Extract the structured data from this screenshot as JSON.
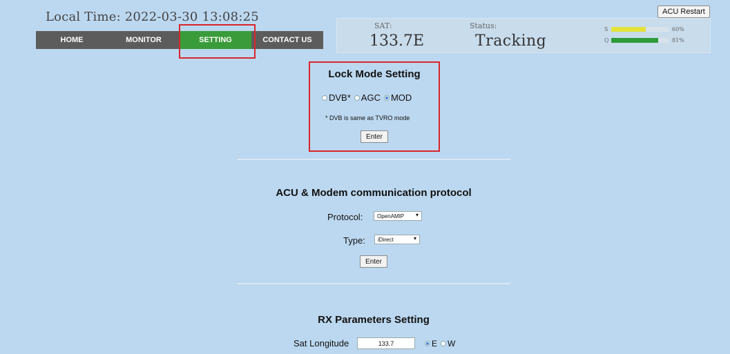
{
  "header": {
    "local_time": "Local Time: 2022-03-30 13:08:25",
    "acu_restart": "ACU Restart"
  },
  "nav": {
    "items": [
      {
        "label": "HOME"
      },
      {
        "label": "MONITOR"
      },
      {
        "label": "SETTING",
        "active": true
      },
      {
        "label": "CONTACT US"
      }
    ]
  },
  "status": {
    "sat_label": "SAT:",
    "sat_value": "133.7E",
    "status_label": "Status:",
    "status_value": "Tracking",
    "signal": {
      "label": "S",
      "percent_text": "60%",
      "value": 0.6,
      "color": "#e3e23a"
    },
    "quality": {
      "label": "Q",
      "percent_text": "81%",
      "value": 0.81,
      "color": "#2e9b3a"
    }
  },
  "lock_mode": {
    "title": "Lock Mode Setting",
    "options": [
      {
        "label": "DVB*",
        "checked": false
      },
      {
        "label": "AGC",
        "checked": false
      },
      {
        "label": "MOD",
        "checked": true
      }
    ],
    "note": "* DVB is same as TVRO mode",
    "enter": "Enter"
  },
  "acu_modem": {
    "title": "ACU & Modem communication protocol",
    "protocol_label": "Protocol:",
    "protocol_value": "OpenAMIP",
    "type_label": "Type:",
    "type_value": "iDirect",
    "enter": "Enter"
  },
  "rx_params": {
    "title": "RX Parameters Setting",
    "sat_longitude_label": "Sat Longitude",
    "sat_longitude_value": "133.7",
    "hemisphere": [
      {
        "label": "E",
        "checked": true
      },
      {
        "label": "W",
        "checked": false
      }
    ]
  },
  "colors": {
    "background": "#bcd8f0",
    "nav_bg": "#5c5c5c",
    "nav_active": "#3a9b3a",
    "highlight": "#d9252a"
  }
}
